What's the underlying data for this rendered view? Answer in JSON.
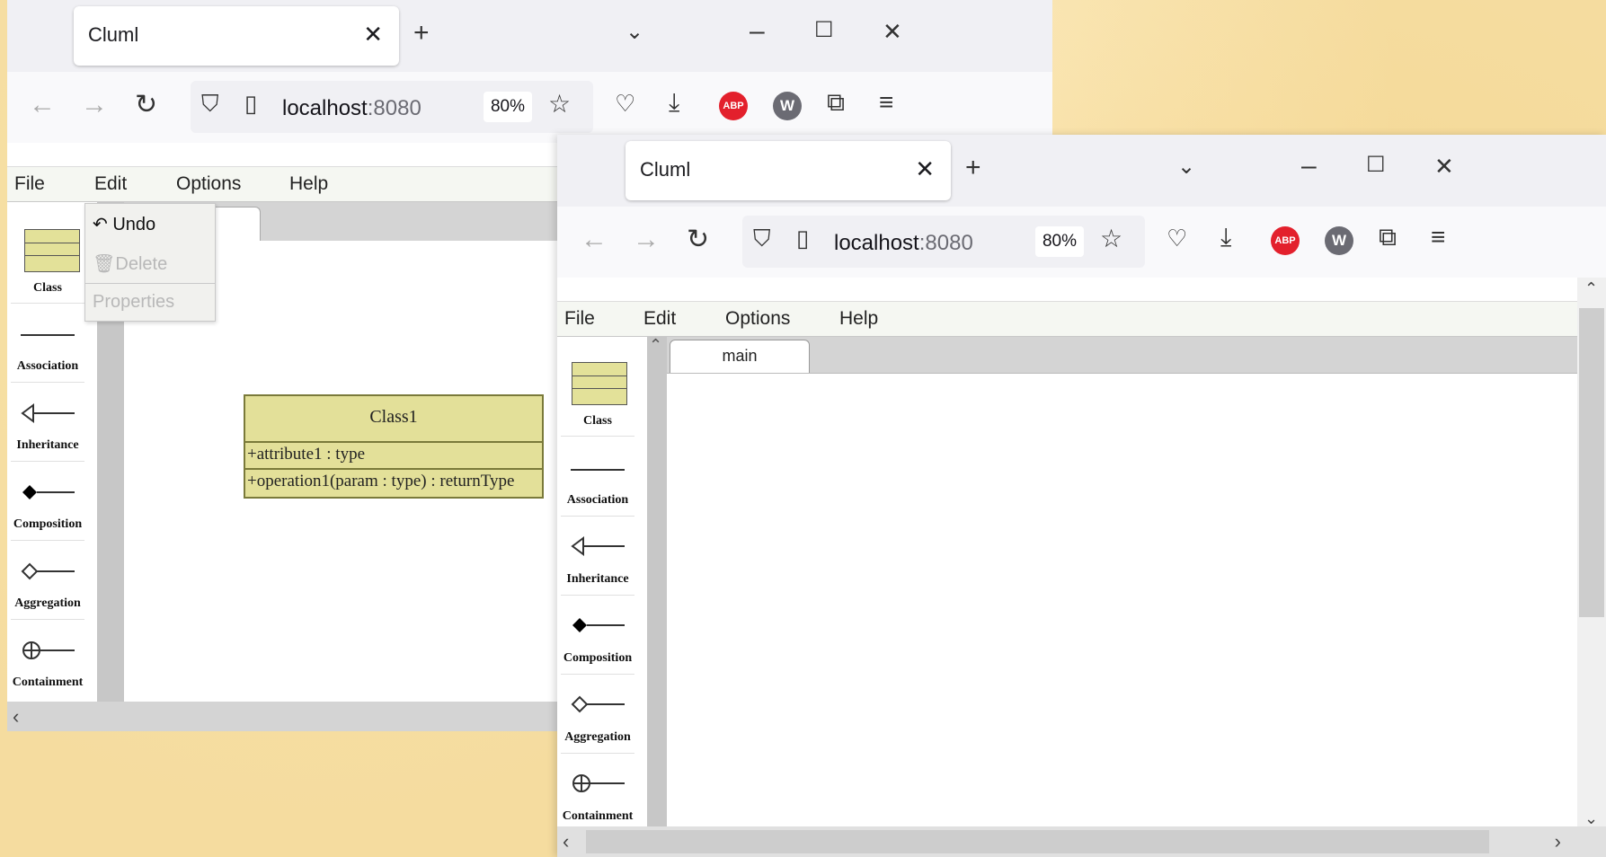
{
  "colors": {
    "desktop": "#f5dc9f",
    "uml_fill": "#e3e099",
    "abp": "#e3202c"
  },
  "browser_back": {
    "tab_title": "Cluml",
    "url_host": "localhost",
    "url_port": ":8080",
    "zoom": "80%",
    "menu": [
      "File",
      "Edit",
      "Options",
      "Help"
    ],
    "edit_menu": {
      "undo": "Undo",
      "delete": "Delete",
      "properties": "Properties"
    },
    "palette": [
      "Class",
      "Association",
      "Inheritance",
      "Composition",
      "Aggregation",
      "Containment"
    ],
    "uml_class": {
      "name": "Class1",
      "attribute": "+attribute1 : type",
      "operation": "+operation1(param : type) : returnType"
    }
  },
  "browser_front": {
    "tab_title": "Cluml",
    "url_host": "localhost",
    "url_port": ":8080",
    "zoom": "80%",
    "menu": [
      "File",
      "Edit",
      "Options",
      "Help"
    ],
    "palette": [
      "Class",
      "Association",
      "Inheritance",
      "Composition",
      "Aggregation",
      "Containment"
    ],
    "canvas_tab": "main"
  },
  "icons": [
    "close-icon",
    "plus-icon",
    "chevron-down-icon",
    "minimize-icon",
    "maximize-icon",
    "back-arrow-icon",
    "forward-arrow-icon",
    "reload-icon",
    "shield-icon",
    "page-icon",
    "star-icon",
    "pocket-icon",
    "download-icon",
    "adblock-icon",
    "w-extension-icon",
    "extensions-icon",
    "hamburger-menu-icon"
  ],
  "abp_text": "ABP",
  "w_text": "W"
}
